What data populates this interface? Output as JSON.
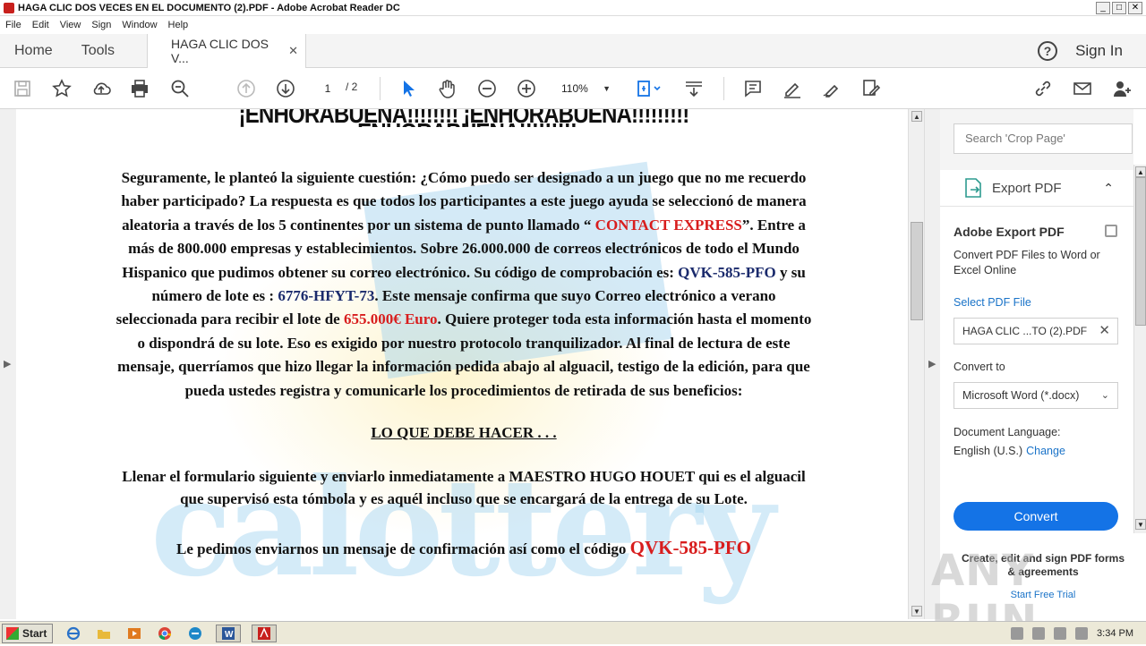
{
  "window": {
    "title": "HAGA CLIC DOS VECES EN EL DOCUMENTO (2).PDF - Adobe Acrobat Reader DC",
    "minimize": "_",
    "maximize": "□",
    "close": "✕"
  },
  "menu": [
    "File",
    "Edit",
    "View",
    "Sign",
    "Window",
    "Help"
  ],
  "tabs": {
    "home": "Home",
    "tools": "Tools",
    "doc_tab": "HAGA CLIC DOS V...",
    "doc_close": "✕",
    "help": "?",
    "signin": "Sign In"
  },
  "toolbar": {
    "page_current": "1",
    "page_total": "/ 2",
    "zoom": "110%",
    "zoom_caret": "▼",
    "icons": [
      "save-icon",
      "bookmark-star-icon",
      "upload-icon",
      "print-icon",
      "search-zoom-icon",
      "page-up-icon",
      "page-down-icon",
      "select-cursor-icon",
      "hand-icon",
      "zoom-out-icon",
      "zoom-in-icon",
      "fit-page-icon",
      "scroll-mode-icon",
      "comment-icon",
      "highlight-icon",
      "sign-icon",
      "edit-tools-icon",
      "link-icon",
      "mail-icon",
      "add-user-icon"
    ]
  },
  "document": {
    "headline": "¡ENHORABUENA!!!!!!!! ¡ENHORABUENA!!!!!!!!! ¡ENHORABUENA!!!!!!!!!",
    "p1_a": "Seguramente, le planteó la siguiente cuestión: ¿Cómo puedo ser designado a un juego que no me recuerdo haber participado? La respuesta es que todos los participantes a este juego ayuda se seleccionó de manera aleatoria a través de los 5 continentes por un sistema de punto llamado “",
    "p1_contact": " CONTACT EXPRESS",
    "p1_b": "”. Entre a más de 800.000 empresas y establecimientos. Sobre 26.000.000 de correos electrónicos de todo el Mundo Hispanico que pudimos obtener su correo electrónico. Su código de comprobación es: ",
    "p1_code": "QVK-585-PFO",
    "p1_c": " y su número de lote es : ",
    "p1_lot": "6776-HFYT-73",
    "p1_d": ". Este mensaje confirma que suyo Correo electrónico a verano seleccionada para recibir el lote de ",
    "p1_amount": "655.000€ Euro",
    "p1_e": ". Quiere proteger toda esta información hasta el momento o dispondrá de su lote. Eso es exigido por nuestro protocolo tranquilizador. Al final de lectura de este mensaje, querríamos que hizo llegar la información pedida abajo al alguacil, testigo de la edición, para que pueda ustedes registra y comunicarle los procedimientos de retirada de sus beneficios:",
    "section": "LO QUE DEBE HACER . . .",
    "p2": "Llenar el formulario siguiente y enviarlo inmediatamente a MAESTRO HUGO HOUET qui es el alguacil que supervisó esta tómbola y es aquél incluso que se encargará de la entrega de su Lote.",
    "p3_a": "Le pedimos enviarnos un mensaje de confirmación así como el código ",
    "p3_code": "QVK-585-PFO",
    "watermark": "calottery"
  },
  "right_pane": {
    "search_placeholder": "Search 'Crop Page'",
    "export_label": "Export PDF",
    "export_chevron": "⌃",
    "title": "Adobe Export PDF",
    "desc": "Convert PDF Files to Word or Excel Online",
    "select_file": "Select PDF File",
    "file_name": "HAGA CLIC ...TO (2).PDF",
    "file_clear": "✕",
    "convert_to_label": "Convert to",
    "format": "Microsoft Word (*.docx)",
    "format_caret": "⌄",
    "lang_label": "Document Language:",
    "lang_value": "English (U.S.)",
    "lang_change": "Change",
    "convert_button": "Convert",
    "promo": "Create, edit and sign PDF forms & agreements",
    "promo_link": "Start Free Trial"
  },
  "overlay_watermark": "ANY RUN",
  "taskbar": {
    "start": "Start",
    "clock": "3:34 PM"
  },
  "colors": {
    "accent": "#1473e6",
    "red_text": "#d81d1d",
    "acrobat_red": "#c8201d"
  }
}
